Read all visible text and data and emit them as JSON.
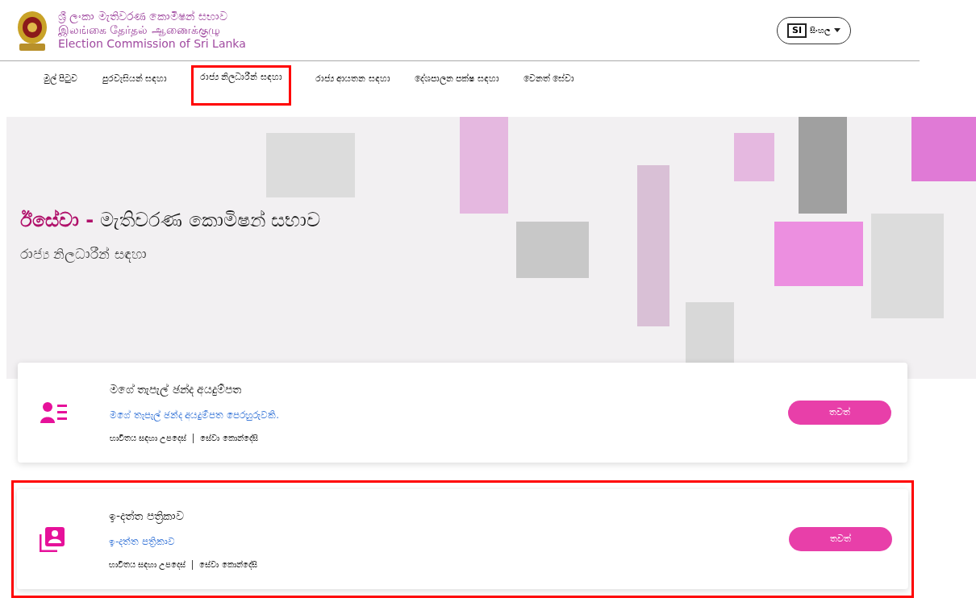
{
  "header": {
    "logo_lines": [
      "ශ්‍රී ලංකා මැතිවරණ කොමිෂන් සභාව",
      "இலங்கை தேர்தல் ஆணைக்குழு",
      "Election Commission of Sri Lanka"
    ],
    "language": {
      "code": "SI",
      "label": "සිංහල"
    }
  },
  "nav": [
    {
      "label": "මුල් පිටුව",
      "highlighted": false
    },
    {
      "label": "පුරවැසියන් සඳහා",
      "highlighted": false
    },
    {
      "label": "රාජ්‍ය නිලධාරීන් සඳහා",
      "highlighted": true
    },
    {
      "label": "රාජ්‍ය ආයතන සඳහා",
      "highlighted": false
    },
    {
      "label": "දේශපාලන පක්ෂ සඳහා",
      "highlighted": false
    },
    {
      "label": "වෙනත් සේවා",
      "highlighted": false
    }
  ],
  "hero": {
    "title_brand": "ඊසේවා -",
    "title_rest": "මැතිවරණ කොමිෂන් සභාව",
    "subtitle": "රාජ්‍ය නිලධාරීන් සඳහා"
  },
  "cards": [
    {
      "kind": "person-list",
      "title": "මගේ තැපැල් ඡන්ද අයදුම්පත",
      "link": "මගේ තැපැල් ඡන්ද අයදුම්පත පෙරහුරුවකි.",
      "footer_links": [
        "භාවිතය සඳහා උපදෙස්",
        "සේවා කොන්දේසි"
      ],
      "button": "තවත්",
      "highlighted": false
    },
    {
      "kind": "profile-stack",
      "title": "ඉ-දත්ත පත්‍රිකාව",
      "link": "ඉ-දත්ත පත්‍රිකාව",
      "footer_links": [
        "භාවිතය සඳහා උපදෙස්",
        "සේවා කොන්දේසි"
      ],
      "button": "තවත්",
      "highlighted": true
    }
  ]
}
